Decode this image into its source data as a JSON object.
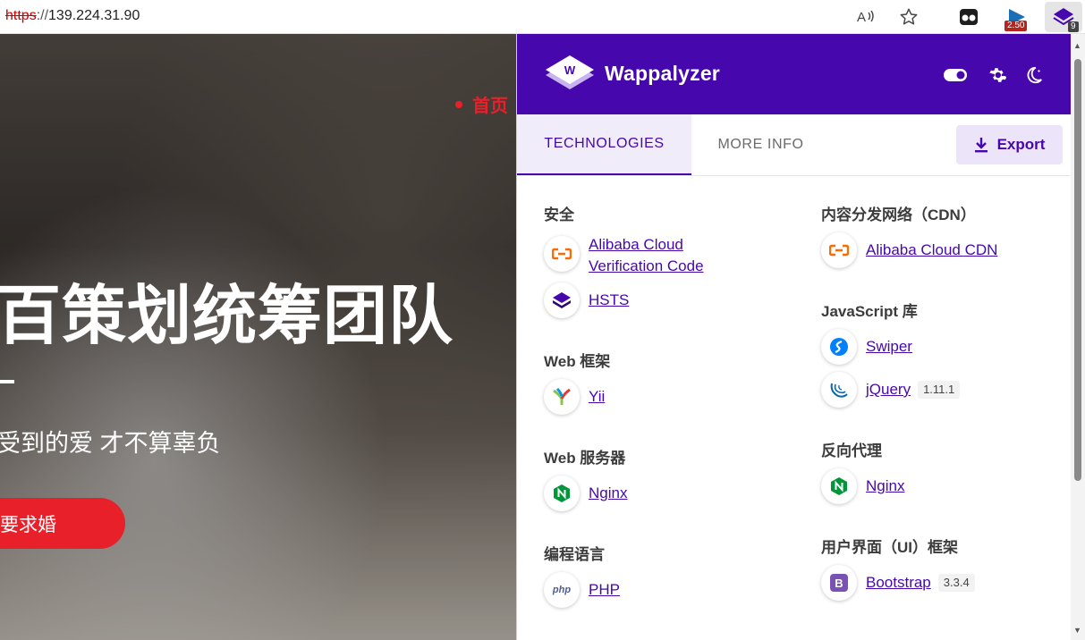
{
  "browser": {
    "url_protocol": "https",
    "url_separator": "://",
    "url_host": "139.224.31.90",
    "read_aloud_icon": "read-aloud-icon",
    "favorite_icon": "star-icon",
    "ext_badge_1": "2.50",
    "ext_badge_2": "9"
  },
  "page": {
    "nav_home": "首页",
    "hero_title": "百策划统筹团队",
    "hero_sub": "受到的爱 才不算辜负",
    "cta_label": "要求婚"
  },
  "wappalyzer": {
    "title": "Wappalyzer",
    "accent": "#4608ad",
    "tabs": {
      "technologies": "TECHNOLOGIES",
      "more_info": "MORE INFO"
    },
    "export_label": "Export",
    "left_column": [
      {
        "category": "安全",
        "items": [
          {
            "name": "Alibaba Cloud Verification Code",
            "line1": "Alibaba Cloud",
            "line2": "Verification Code",
            "icon": "alibaba-cloud-icon"
          },
          {
            "name": "HSTS",
            "icon": "hsts-icon"
          }
        ]
      },
      {
        "category": "Web 框架",
        "items": [
          {
            "name": "Yii",
            "icon": "yii-icon"
          }
        ]
      },
      {
        "category": "Web 服务器",
        "items": [
          {
            "name": "Nginx",
            "icon": "nginx-icon"
          }
        ]
      },
      {
        "category": "编程语言",
        "items": [
          {
            "name": "PHP",
            "icon": "php-icon"
          }
        ]
      }
    ],
    "right_column": [
      {
        "category": "内容分发网络（CDN）",
        "items": [
          {
            "name": "Alibaba Cloud CDN",
            "icon": "alibaba-cloud-icon"
          }
        ]
      },
      {
        "category": "JavaScript 库",
        "items": [
          {
            "name": "Swiper",
            "icon": "swiper-icon"
          },
          {
            "name": "jQuery",
            "version": "1.11.1",
            "icon": "jquery-icon"
          }
        ]
      },
      {
        "category": "反向代理",
        "items": [
          {
            "name": "Nginx",
            "icon": "nginx-icon"
          }
        ]
      },
      {
        "category": "用户界面（UI）框架",
        "items": [
          {
            "name": "Bootstrap",
            "version": "3.3.4",
            "icon": "bootstrap-icon"
          }
        ]
      }
    ],
    "php_icon_text": "php",
    "bootstrap_icon_text": "B"
  }
}
